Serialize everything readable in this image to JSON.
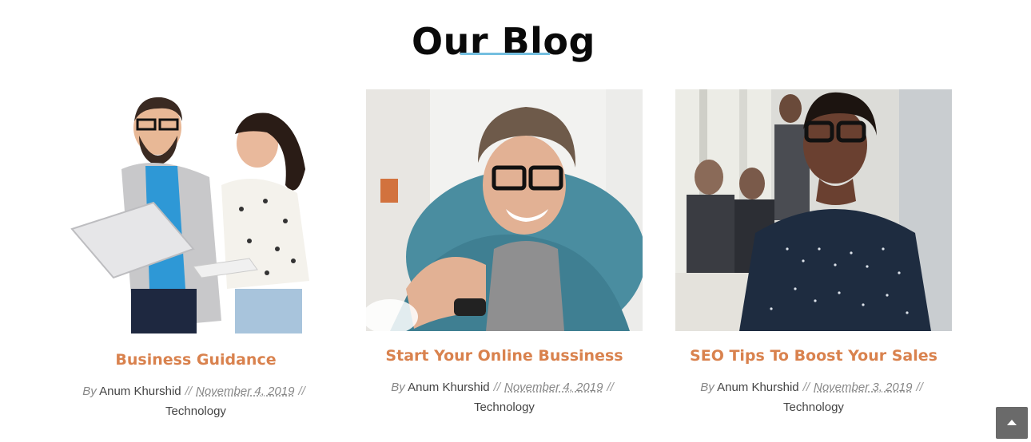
{
  "section": {
    "title": "Our Blog",
    "accent": "#74bfe0"
  },
  "posts": [
    {
      "title": "Business Guidance",
      "by": "By",
      "author": "Anum Khurshid",
      "date": "November 4, 2019",
      "category": "Technology",
      "image": "two-people-with-laptop-photo"
    },
    {
      "title": "Start Your Online Bussiness",
      "by": "By",
      "author": "Anum Khurshid",
      "date": "November 4, 2019",
      "category": "Technology",
      "image": "smiling-man-with-glasses-photo"
    },
    {
      "title": "SEO Tips To Boost Your Sales",
      "by": "By",
      "author": "Anum Khurshid",
      "date": "November 3, 2019",
      "category": "Technology",
      "image": "businesswoman-in-office-photo"
    }
  ],
  "colors": {
    "title": "#d9824e",
    "meta": "#444444",
    "scroll_button": "#6a6a6a"
  },
  "scroll_top": {
    "icon": "chevron-up-icon"
  }
}
